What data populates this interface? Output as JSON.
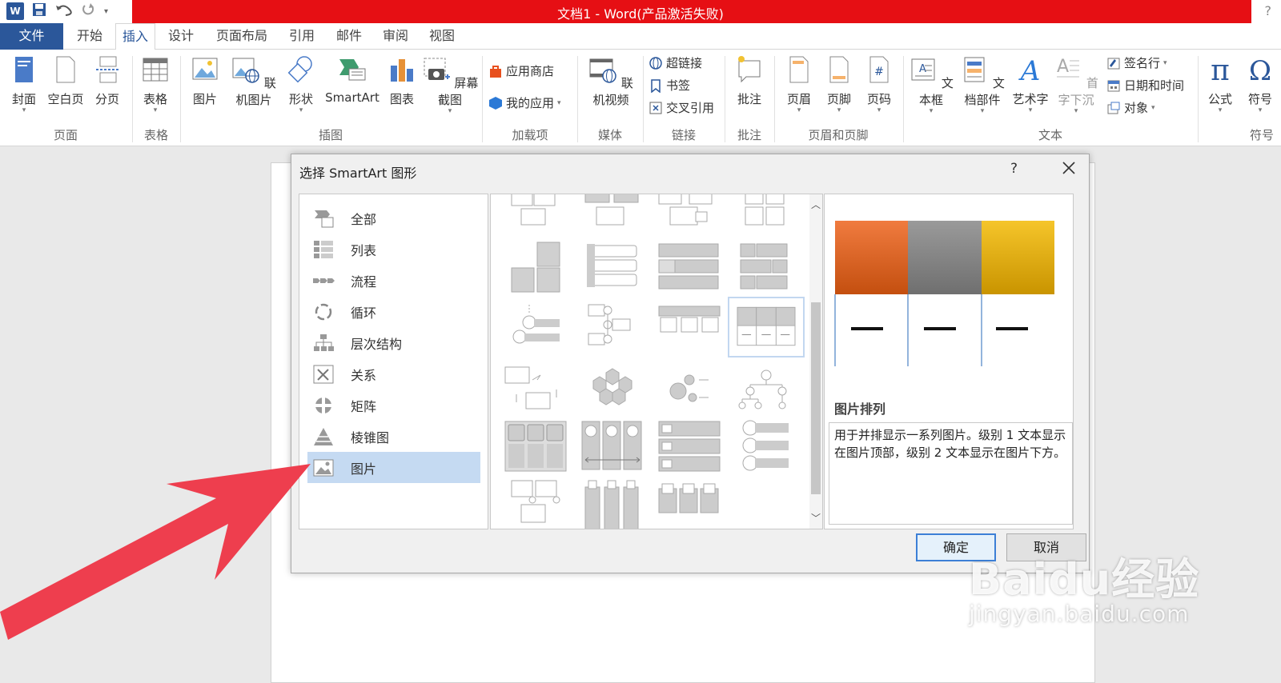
{
  "window": {
    "title": "文档1 -  Word(产品激活失败)",
    "help": "?"
  },
  "tabs": {
    "file": "文件",
    "items": [
      "开始",
      "插入",
      "设计",
      "页面布局",
      "引用",
      "邮件",
      "审阅",
      "视图"
    ],
    "active": "插入"
  },
  "ribbon": {
    "page_group": {
      "label": "页面",
      "cover": "封面",
      "blank": "空白页",
      "break": "分页"
    },
    "table_group": {
      "label": "表格",
      "table": "表格"
    },
    "illustrations": {
      "label": "插图",
      "picture": "图片",
      "online_picture": "联机图片",
      "shapes": "形状",
      "smartart": "SmartArt",
      "chart": "图表",
      "screenshot": "屏幕截图"
    },
    "addins": {
      "label": "加载项",
      "store": "应用商店",
      "my_apps": "我的应用"
    },
    "media": {
      "label": "媒体",
      "online_video": "联机视频"
    },
    "links": {
      "label": "链接",
      "hyperlink": "超链接",
      "bookmark": "书签",
      "cross_ref": "交叉引用"
    },
    "comments": {
      "label": "批注",
      "comment": "批注"
    },
    "header_footer": {
      "label": "页眉和页脚",
      "header": "页眉",
      "footer": "页脚",
      "page_number": "页码"
    },
    "text": {
      "label": "文本",
      "textbox": "文本框",
      "quick_parts": "文档部件",
      "wordart": "艺术字",
      "dropcap": "首字下沉",
      "signature": "签名行",
      "datetime": "日期和时间",
      "object": "对象"
    },
    "symbols": {
      "label": "符号",
      "equation": "公式",
      "symbol": "符号"
    }
  },
  "dialog": {
    "title": "选择 SmartArt 图形",
    "help": "?",
    "categories": [
      "全部",
      "列表",
      "流程",
      "循环",
      "层次结构",
      "关系",
      "矩阵",
      "棱锥图",
      "图片"
    ],
    "selected_category": "图片",
    "preview": {
      "name": "图片排列",
      "description": "用于并排显示一系列图片。级别 1 文本显示在图片顶部，级别 2 文本显示在图片下方。",
      "colors": [
        "#e06820",
        "#8c8c8c",
        "#e8b818"
      ]
    },
    "ok": "确定",
    "cancel": "取消"
  },
  "watermark": {
    "brand": "Baidu经验",
    "url": "jingyan.baidu.com"
  },
  "colors": {
    "titlebar": "#e60f14",
    "accent": "#2b579a",
    "selection": "#c5daf2",
    "arrow": "#ee3e4e"
  }
}
